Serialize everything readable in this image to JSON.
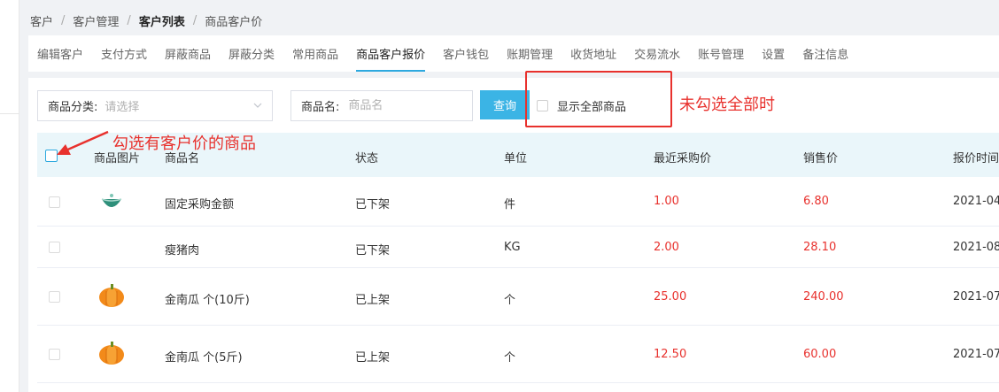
{
  "breadcrumb": [
    "客户",
    "客户管理",
    "客户列表",
    "商品客户价"
  ],
  "tabs": [
    {
      "label": "编辑客户",
      "active": false
    },
    {
      "label": "支付方式",
      "active": false
    },
    {
      "label": "屏蔽商品",
      "active": false
    },
    {
      "label": "屏蔽分类",
      "active": false
    },
    {
      "label": "常用商品",
      "active": false
    },
    {
      "label": "商品客户报价",
      "active": true
    },
    {
      "label": "客户钱包",
      "active": false
    },
    {
      "label": "账期管理",
      "active": false
    },
    {
      "label": "收货地址",
      "active": false
    },
    {
      "label": "交易流水",
      "active": false
    },
    {
      "label": "账号管理",
      "active": false
    },
    {
      "label": "设置",
      "active": false
    },
    {
      "label": "备注信息",
      "active": false
    }
  ],
  "filters": {
    "category_label": "商品分类:",
    "category_placeholder": "请选择",
    "name_label": "商品名:",
    "name_placeholder": "商品名",
    "query_button": "查询",
    "show_all_label": "显示全部商品",
    "show_all_checked": false
  },
  "annotations": {
    "unchecked_note": "未勾选全部时",
    "checkbox_note": "勾选有客户价的商品"
  },
  "table": {
    "headers": [
      "商品图片",
      "商品名",
      "状态",
      "单位",
      "最近采购价",
      "销售价",
      "报价时间"
    ],
    "rows": [
      {
        "image": "bowl-icon",
        "name": "固定采购金额",
        "status": "已下架",
        "unit": "件",
        "last_price": "1.00",
        "sale_price": "6.80",
        "quote_time": "2021-04"
      },
      {
        "image": "",
        "name": "瘦猪肉",
        "status": "已下架",
        "unit": "KG",
        "last_price": "2.00",
        "sale_price": "28.10",
        "quote_time": "2021-08"
      },
      {
        "image": "pumpkin-icon",
        "name": "金南瓜 个(10斤)",
        "status": "已上架",
        "unit": "个",
        "last_price": "25.00",
        "sale_price": "240.00",
        "quote_time": "2021-07"
      },
      {
        "image": "pumpkin-icon",
        "name": "金南瓜 个(5斤)",
        "status": "已上架",
        "unit": "个",
        "last_price": "12.50",
        "sale_price": "60.00",
        "quote_time": "2021-07"
      }
    ]
  },
  "colors": {
    "accent": "#2ea9df",
    "annotation": "#e8312d",
    "price": "#e8312d",
    "header_bg": "#eaf6fa"
  }
}
